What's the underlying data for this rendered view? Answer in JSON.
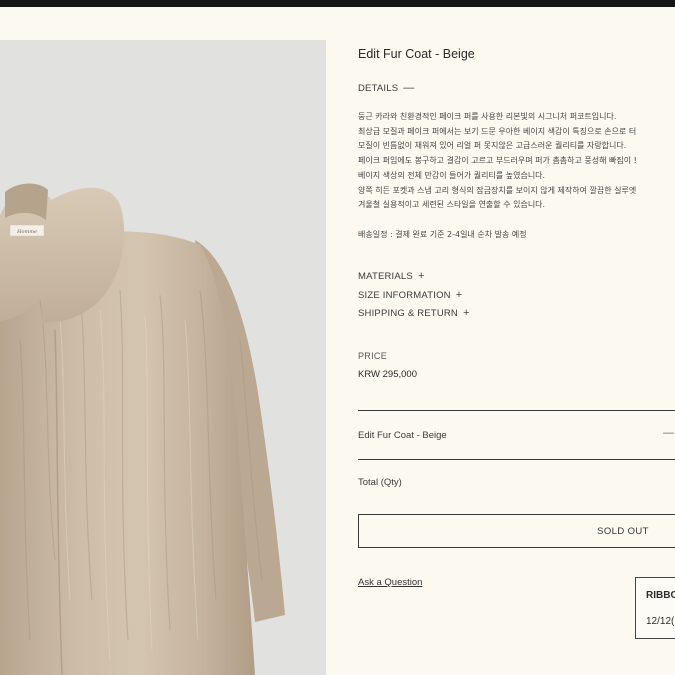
{
  "product": {
    "title": "Edit Fur Coat - Beige",
    "image_alt": "Beige faux fur coat with round collar",
    "label_text": "Homme"
  },
  "sections": {
    "details": {
      "label": "DETAILS",
      "toggle_symbol": "—",
      "expanded": true
    },
    "materials": {
      "label": "MATERIALS",
      "toggle_symbol": "+"
    },
    "size_information": {
      "label": "SIZE INFORMATION",
      "toggle_symbol": "+"
    },
    "shipping_return": {
      "label": "SHIPPING & RETURN",
      "toggle_symbol": "+"
    }
  },
  "description": {
    "lines": [
      "둥근 카라와 친환경적인 페이크 퍼를 사용한 리본빛의 시그니처 퍼코트입니다.",
      "최상급 모질과 페이크 퍼에서는 보기 드문 우아한 베이지 색감이 특징으로 손으로 터",
      "모질이 빈틈없이 채워져 있어 리얼 퍼 못지않은 고급스러운 퀄리티를 자랑합니다.",
      "페이크 퍼임에도 봉구하고 결감이 고르고 부드러우며 퍼가 촘촘하고 풍성해 빠짐이 !",
      "베이지 색상의 전체 만감이 들어가 퀄리티를 높였습니다.",
      "양쪽 히든 포켓과 스냅 고리 형식의 잠금장치를 보이지 않게 제작하여 깔끔한 실루엣",
      "겨울철 실용적이고 세련된 스타일을 연출할 수 있습니다."
    ],
    "shipping_note": "배송일정 : 결제 완료 기준 2-4일내 순차 발송 예정"
  },
  "price": {
    "label": "PRICE",
    "value": "KRW 295,000"
  },
  "selected_option": {
    "name": "Edit Fur Coat - Beige",
    "remove_symbol": "—"
  },
  "total": {
    "label": "Total (Qty)"
  },
  "buttons": {
    "sold_out": "SOLD OUT",
    "ask": "Ask a Question"
  },
  "ribbon_card": {
    "title": "RIBBO",
    "date": "12/12("
  },
  "colors": {
    "page_background": "#fcf9f0",
    "image_background": "#e1e1df",
    "coat_beige": "#c8b8a3",
    "text": "#2b2b2b",
    "topbar": "#161616"
  }
}
